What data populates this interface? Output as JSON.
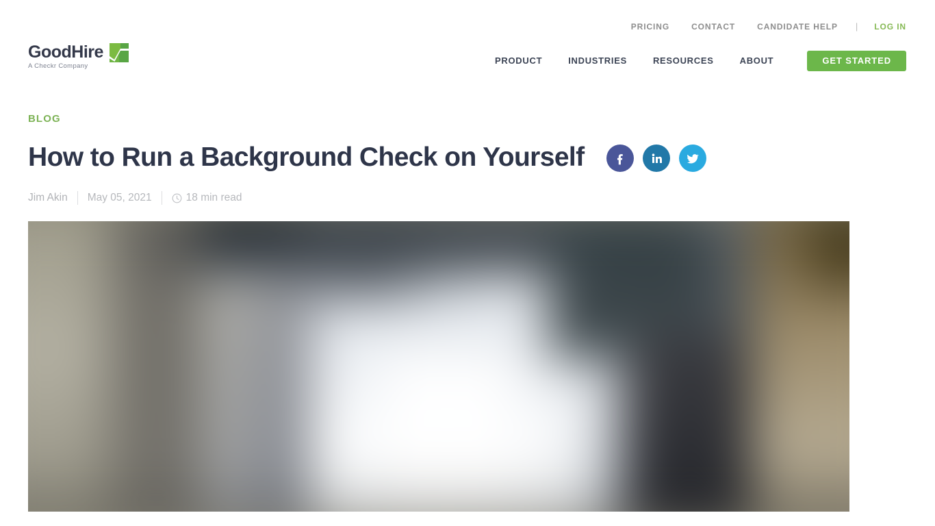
{
  "header": {
    "logo": {
      "word": "GoodHire",
      "tagline": "A Checkr Company",
      "mark_color_light": "#7cbb42",
      "mark_color_dark": "#58a544"
    },
    "utility_nav": [
      {
        "label": "PRICING",
        "name": "pricing"
      },
      {
        "label": "CONTACT",
        "name": "contact"
      },
      {
        "label": "CANDIDATE HELP",
        "name": "candidate-help"
      }
    ],
    "utility_separator": "|",
    "login_label": "LOG IN",
    "login_color": "#86b955",
    "main_nav": [
      {
        "label": "PRODUCT",
        "name": "product"
      },
      {
        "label": "INDUSTRIES",
        "name": "industries"
      },
      {
        "label": "RESOURCES",
        "name": "resources"
      },
      {
        "label": "ABOUT",
        "name": "about"
      }
    ],
    "cta_label": "GET STARTED",
    "cta_color": "#6cb74a"
  },
  "article": {
    "eyebrow": "BLOG",
    "eyebrow_color": "#7db356",
    "title": "How to Run a Background Check on Yourself",
    "title_color": "#2e3549",
    "author": "Jim Akin",
    "date": "May 05, 2021",
    "read_time": "18 min read",
    "read_time_icon": "clock-icon"
  },
  "share": [
    {
      "network": "facebook",
      "glyph": "f",
      "color": "#4a5699"
    },
    {
      "network": "linkedin",
      "glyph": "in",
      "color": "#2178a8"
    },
    {
      "network": "twitter",
      "glyph": "bird",
      "color": "#2aaae0"
    }
  ],
  "hero": {
    "alt": "blurred office interior with laptop screen",
    "blurred": true
  }
}
